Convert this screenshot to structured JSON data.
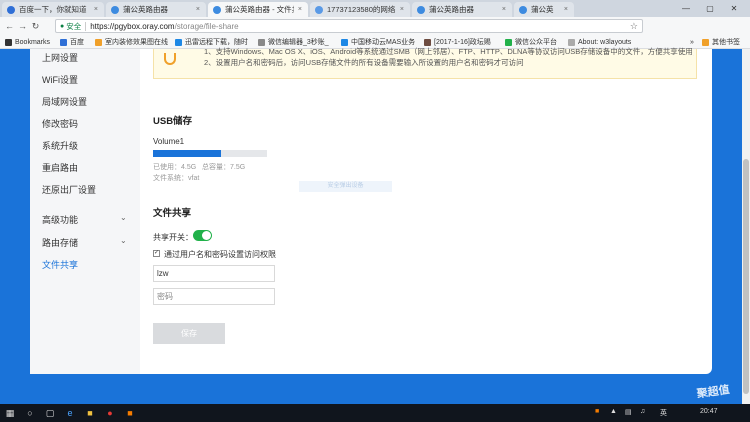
{
  "browser": {
    "tabs": [
      {
        "label": "百度一下，你就知道",
        "close": "×"
      },
      {
        "label": "蒲公英路由器",
        "close": "×"
      },
      {
        "label": "蒲公英路由器 - 文件共享",
        "close": "×"
      },
      {
        "label": "17737123580的网络",
        "close": "×"
      },
      {
        "label": "蒲公英路由器",
        "close": "×"
      },
      {
        "label": "蒲公英",
        "close": "×"
      }
    ],
    "window_controls": {
      "minimize": "—",
      "maximize": "▢",
      "close": "✕"
    },
    "nav": {
      "back": "←",
      "forward": "→",
      "reload": "↻"
    },
    "secure_label": "安全",
    "url_host": "https://pgybox.oray.com",
    "url_path": "/storage/file-share",
    "star": "☆",
    "extensions": [
      "S",
      "A",
      "E",
      "W",
      "i",
      "M",
      "P"
    ],
    "menu": "⋮"
  },
  "bookmarks": {
    "label": "Bookmarks",
    "items": [
      "百度",
      "室内装修效果图在线",
      "迅雷远程下载，随时",
      "微信编辑器_3秒账_",
      "中国移动云MAS业务",
      "[2017-1-16]政坛赐",
      "微信公众平台",
      "About: w3layouts"
    ],
    "overflow": "»",
    "other": "其他书签"
  },
  "sidebar": {
    "items": [
      {
        "label": "上网设置"
      },
      {
        "label": "WiFi设置"
      },
      {
        "label": "局域网设置"
      },
      {
        "label": "修改密码"
      },
      {
        "label": "系统升级"
      },
      {
        "label": "重启路由"
      },
      {
        "label": "还原出厂设置"
      },
      {
        "label": "高级功能",
        "chevron": "⌄"
      },
      {
        "label": "路由存储",
        "chevron": "⌄"
      },
      {
        "label": "文件共享"
      }
    ]
  },
  "notice": {
    "line1": "1、支持Windows、Mac OS X、iOS、Android等系统通过SMB（网上邻居）、FTP、HTTP、DLNA等协议访问USB存储设备中的文件，方便共享使用；支持局域网共享和远程访问",
    "line2": "2、设置用户名和密码后，访问USB存储文件的所有设备需要输入所设置的用户名和密码才可访问"
  },
  "usb": {
    "title": "USB储存",
    "volume": "Volume1",
    "usage_fraction": 0.6,
    "used_label": "已使用：",
    "used_value": "4.5G",
    "total_label": "总容量：",
    "total_value": "7.5G",
    "fs_label": "文件系统：",
    "fs_value": "vfat",
    "eject_label": "安全弹出设备"
  },
  "share": {
    "title": "文件共享",
    "switch_label": "共享开关：",
    "switch_on": true,
    "auth_checked": true,
    "check_mark": "✓",
    "auth_label": "通过用户名和密码设置访问权限",
    "username_value": "lzw",
    "password_placeholder": "密码",
    "save_label": "保存"
  },
  "taskbar": {
    "ime": "英",
    "time": "20:47",
    "watermark": "聚超值"
  },
  "colors": {
    "accent": "#1a73d9",
    "toggle": "#21b14a",
    "notice_bg": "#fffbe6"
  }
}
